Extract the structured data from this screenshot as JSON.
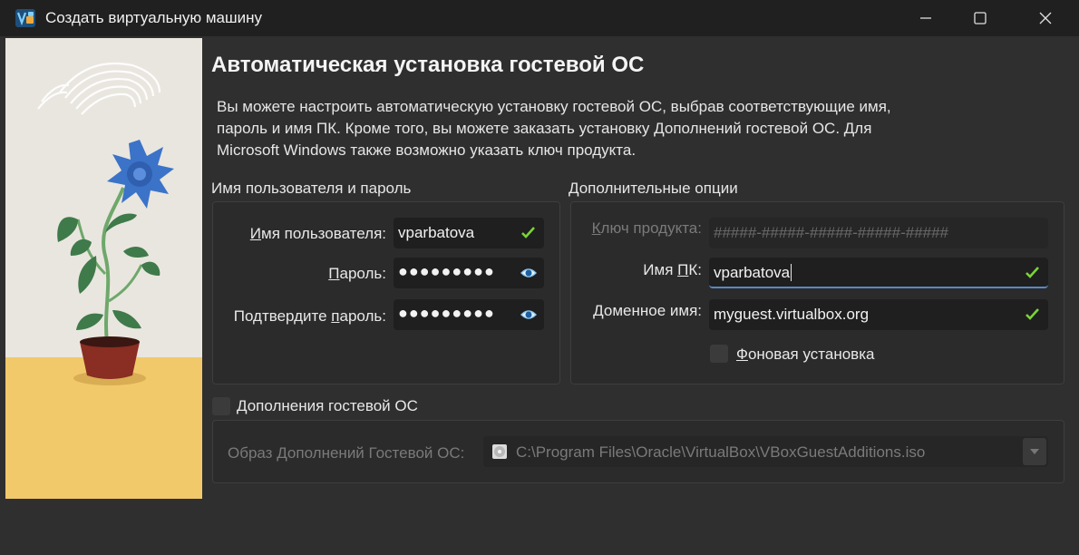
{
  "window": {
    "title": "Создать виртуальную машину",
    "minimize_icon": "minimize-icon",
    "maximize_icon": "maximize-icon",
    "close_icon": "close-icon"
  },
  "page": {
    "heading": "Автоматическая установка гостевой ОС",
    "description": "Вы можете настроить автоматическую установку гостевой ОС, выбрав соответствующие имя,\nпароль и имя ПК. Кроме того, вы можете заказать установку Дополнений гостевой ОС. Для\nMicrosoft Windows также возможно указать ключ продукта."
  },
  "user_group": {
    "title": "Имя пользователя и пароль",
    "username": {
      "label_pre": "",
      "label_ul": "И",
      "label_post": "мя пользователя:",
      "value": "vparbatova"
    },
    "password": {
      "label_pre": "",
      "label_ul": "П",
      "label_post": "ароль:",
      "value": "●●●●●●●●●"
    },
    "confirm": {
      "label_pre": "Подтвердите ",
      "label_ul": "п",
      "label_post": "ароль:",
      "value": "●●●●●●●●●"
    }
  },
  "options_group": {
    "title": "Дополнительные опции",
    "product_key": {
      "label_pre": "",
      "label_ul": "К",
      "label_post": "люч продукта:",
      "placeholder": "#####-#####-#####-#####-#####"
    },
    "hostname": {
      "label_pre": "Имя ",
      "label_ul": "П",
      "label_post": "К:",
      "value": "vparbatova"
    },
    "domain": {
      "label_pre": "",
      "label_ul": "Д",
      "label_post": "оменное имя:",
      "value": "myguest.virtualbox.org"
    },
    "unattended": {
      "label_pre": "",
      "label_ul": "Ф",
      "label_post": "оновая установка",
      "checked": false
    }
  },
  "guest_additions": {
    "checkbox": {
      "label_pre": "",
      "label_ul": "Д",
      "label_post": "ополнения гостевой ОС",
      "checked": false
    },
    "iso_label": {
      "label_pre": "Образ ",
      "label_ul": "Д",
      "label_post": "ополнений Гостевой ОС:"
    },
    "iso_path": "C:\\Program Files\\Oracle\\VirtualBox\\VBoxGuestAdditions.iso"
  },
  "colors": {
    "accent": "#5a87c5",
    "valid_check": "#7bd33a",
    "eye_icon": "#8fc8f0"
  }
}
